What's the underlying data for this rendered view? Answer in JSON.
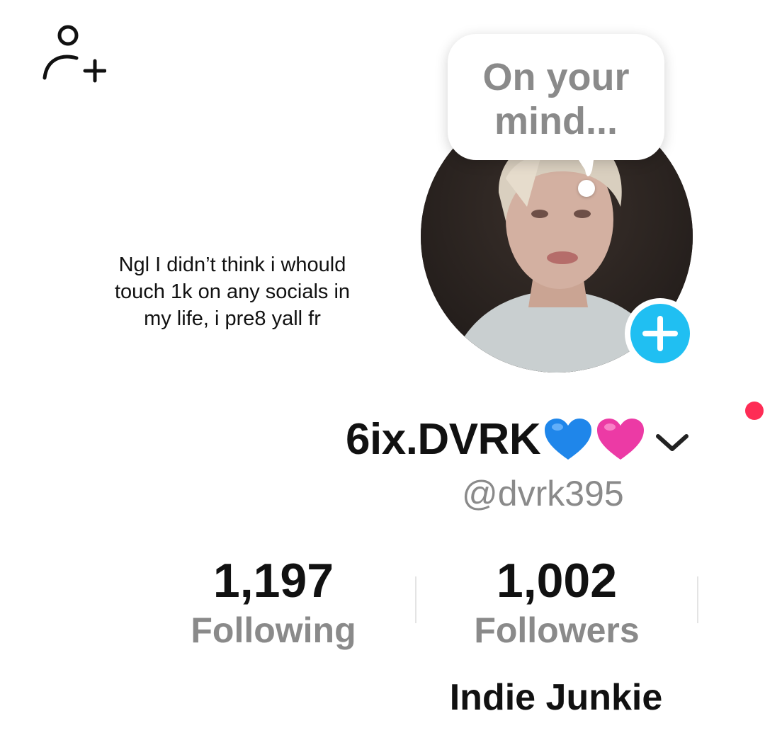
{
  "caption": {
    "line1": "Ngl I didn’t think i whould",
    "line2": "touch 1k on any socials in",
    "line3": "my life, i pre8 yall fr"
  },
  "note_bubble": {
    "line1": "On your",
    "line2": "mind..."
  },
  "profile": {
    "display_name": "6ix.DVRK",
    "handle": "@dvrk395",
    "bio": "Indie Junkie"
  },
  "stats": {
    "following_count": "1,197",
    "following_label": "Following",
    "followers_count": "1,002",
    "followers_label": "Followers"
  },
  "icons": {
    "add_friend": "person-plus-icon",
    "avatar_add": "plus-icon",
    "name_dropdown": "chevron-down-icon",
    "emoji_1": "blue-heart-icon",
    "emoji_2": "pink-heart-icon"
  },
  "colors": {
    "accent_blue": "#20bff2",
    "notification_red": "#fe2c55",
    "blue_heart": "#1f86ea",
    "pink_heart": "#ec3aa5",
    "secondary_text": "#8a8a8a"
  }
}
